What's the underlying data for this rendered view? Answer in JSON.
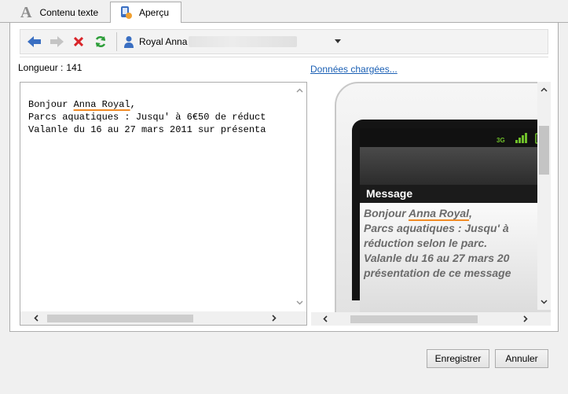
{
  "tabs": [
    {
      "label": "Contenu texte",
      "icon": "text-a-icon"
    },
    {
      "label": "Aperçu",
      "icon": "preview-icon"
    }
  ],
  "toolbar": {
    "back_icon": "arrow-left-icon",
    "forward_icon": "arrow-right-icon",
    "delete_icon": "delete-x-icon",
    "refresh_icon": "refresh-icon",
    "user_name": "Royal Anna"
  },
  "length": {
    "label": "Longueur :",
    "value": "141"
  },
  "loaded_link": "Données chargées...",
  "text_content": {
    "line1_prefix": "Bonjour ",
    "line1_name": "Anna Royal",
    "line1_suffix": ",",
    "line2": "Parcs aquatiques : Jusqu' à 6€50 de réduct",
    "line3": "Valanle du 16 au 27 mars 2011 sur présenta"
  },
  "phone": {
    "header": "Message",
    "line1_prefix": "Bonjour ",
    "line1_name": "Anna Royal",
    "line1_suffix": ",",
    "line2": "Parcs aquatiques : Jusqu' à",
    "line3": "réduction selon le parc.",
    "line4": "Valanle du 16 au 27 mars 20",
    "line5": "présentation de ce message",
    "status_network": "3G"
  },
  "buttons": {
    "save": "Enregistrer",
    "cancel": "Annuler"
  },
  "colors": {
    "accent_link": "#1a5fb4",
    "spell_underline": "#f08a24",
    "delete_red": "#d9252a",
    "refresh_green": "#2e9e3a",
    "nav_blue": "#3a6fc2"
  }
}
